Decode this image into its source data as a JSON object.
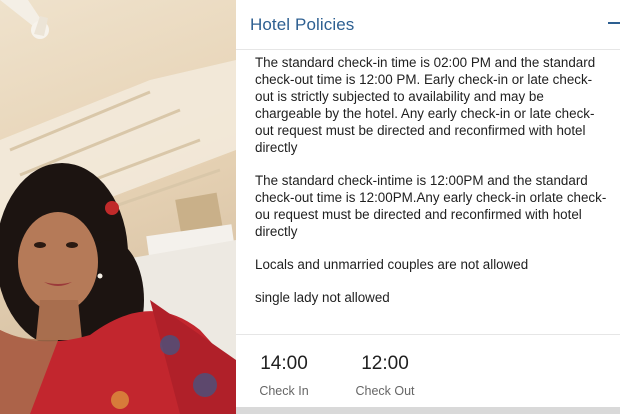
{
  "photo": {
    "alt_subject": "woman selfie"
  },
  "policies": {
    "title": "Hotel Policies",
    "collapse_icon": "minus-icon",
    "items": [
      "The standard check-in time is 02:00 PM and the standard check-out time is 12:00 PM. Early check-in or late check-out is strictly subjected to availability and may be chargeable by the hotel. Any early check-in or late check-out request must be directed and reconfirmed with hotel directly",
      "The standard check-intime is 12:00PM and the standard check-out time is 12:00PM.Any early check-in orlate check-ou request must be directed and reconfirmed with hotel directly",
      "Locals and unmarried couples are not allowed",
      "single lady not allowed"
    ]
  },
  "times": {
    "check_in": {
      "value": "14:00",
      "label": "Check In"
    },
    "check_out": {
      "value": "12:00",
      "label": "Check Out"
    }
  }
}
